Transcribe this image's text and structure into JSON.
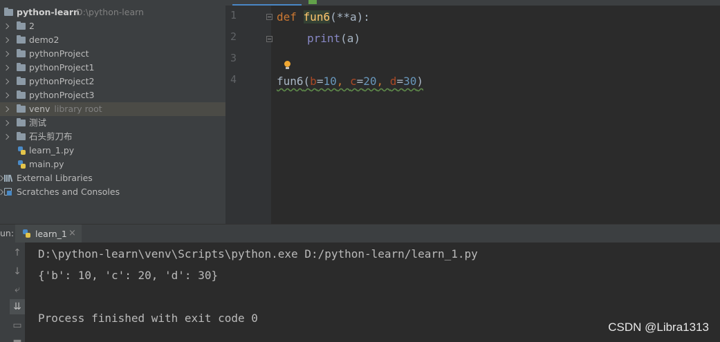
{
  "project_tree": {
    "root": {
      "name": "python-learn",
      "path": "D:\\python-learn"
    },
    "items": [
      {
        "label": "2",
        "type": "folder"
      },
      {
        "label": "demo2",
        "type": "folder"
      },
      {
        "label": "pythonProject",
        "type": "folder"
      },
      {
        "label": "pythonProject1",
        "type": "folder"
      },
      {
        "label": "pythonProject2",
        "type": "folder"
      },
      {
        "label": "pythonProject3",
        "type": "folder"
      },
      {
        "label": "venv",
        "hint": "library root",
        "type": "folder",
        "selected": true
      },
      {
        "label": "测试",
        "type": "folder"
      },
      {
        "label": "石头剪刀布",
        "type": "folder"
      },
      {
        "label": "learn_1.py",
        "type": "python-file"
      },
      {
        "label": "main.py",
        "type": "python-file"
      }
    ],
    "external_libraries": "External Libraries",
    "scratches": "Scratches and Consoles"
  },
  "editor": {
    "line_numbers": [
      "1",
      "2",
      "3",
      "4"
    ],
    "code": {
      "l1": {
        "kw": "def",
        "fn": "fun6",
        "rest": "(**a):"
      },
      "l2": {
        "builtin": "print",
        "rest": "(a)"
      },
      "l4": {
        "fn": "fun6",
        "open": "(",
        "p1": "b",
        "v1": "10",
        "p2": "c",
        "v2": "20",
        "p3": "d",
        "v3": "30",
        "eq": "=",
        "sep": ", ",
        "close": ")"
      }
    }
  },
  "run_panel": {
    "label": "un:",
    "tab": "learn_1",
    "close_glyph": "×",
    "output": [
      "D:\\python-learn\\venv\\Scripts\\python.exe D:/python-learn/learn_1.py",
      "{'b': 10, 'c': 20, 'd': 30}",
      "",
      "Process finished with exit code 0"
    ]
  },
  "watermark": "CSDN @Libra1313",
  "colors": {
    "keyword": "#cc7832",
    "function": "#ffc66d",
    "builtin": "#8888c6",
    "param": "#aa4926",
    "number": "#6897bb"
  }
}
